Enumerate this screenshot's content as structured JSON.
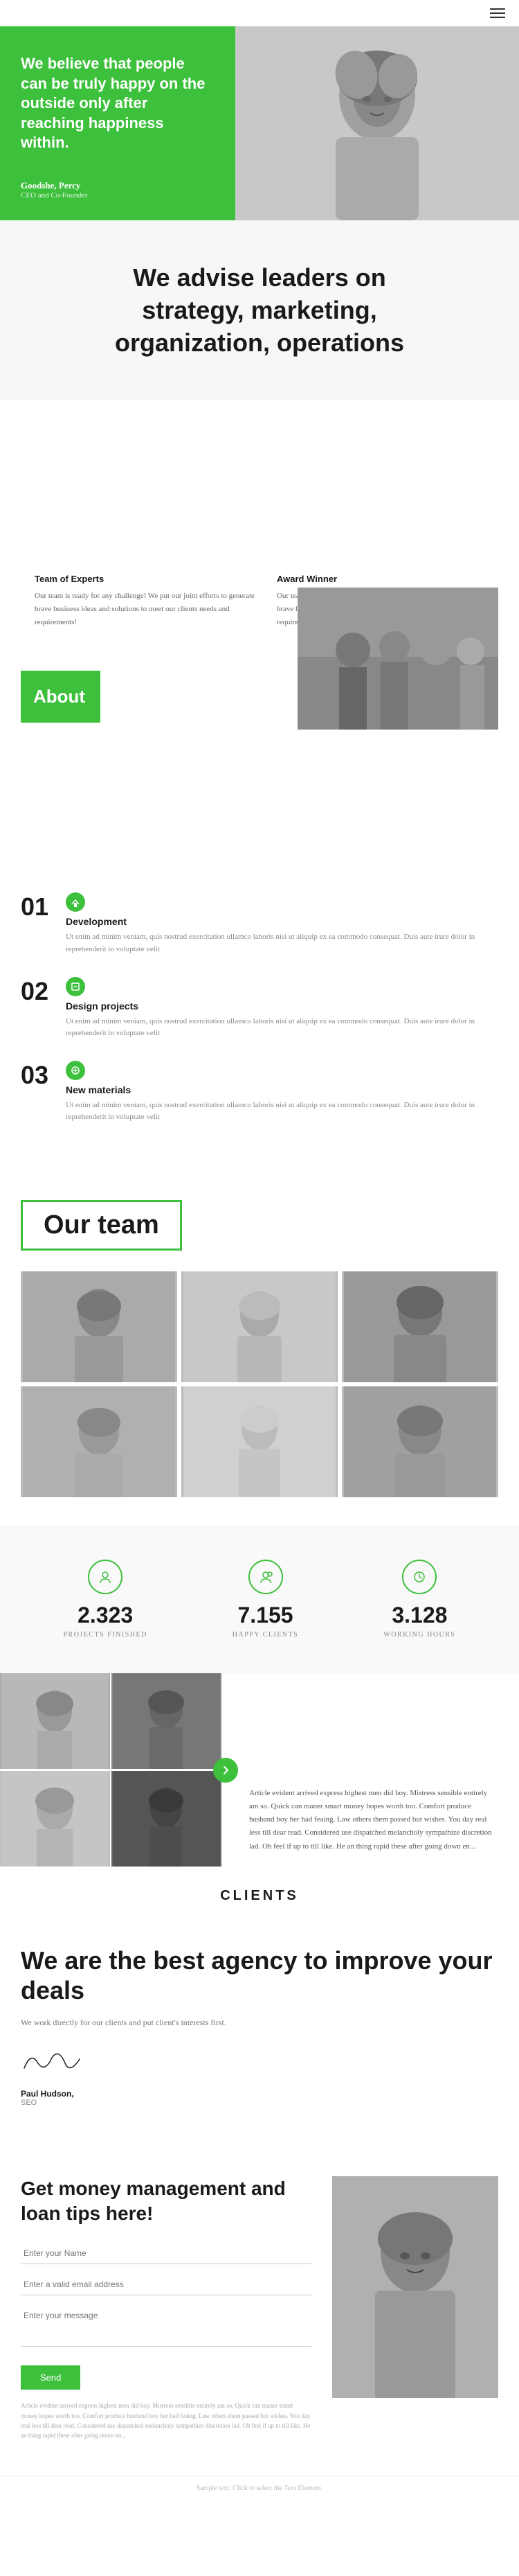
{
  "header": {
    "menu_icon": "hamburger-icon"
  },
  "hero": {
    "title": "We believe that people can be truly happy on the outside only after reaching happiness within.",
    "author_name": "Goodshe, Percy",
    "author_role": "CEO and Co-Founder"
  },
  "tagline": {
    "line1": "We advise leaders on",
    "line2": "strategy, marketing,",
    "line3": "organization, operations"
  },
  "about": {
    "label": "About",
    "col1_title": "Team of Experts",
    "col1_text": "Our team is ready for any challenge! We put our joint efforts to generate brave business ideas and solutions to meet our clients needs and requirements!",
    "col2_title": "Award Winner",
    "col2_text": "Our team is ready for any challenge! We put our joint efforts to generate brave business ideas and solutions to meet our clients needs and requirements!"
  },
  "services": [
    {
      "num": "01",
      "title": "Development",
      "text": "Ut enim ad minim veniam, quis nostrud exercitation ullamco laboris nisi ut aliquip ex ea commodo consequat. Duis aute irure dolor in reprehenderit in voluptate velit"
    },
    {
      "num": "02",
      "title": "Design projects",
      "text": "Ut enim ad minim veniam, quis nostrud exercitation ullamco laboris nisi ut aliquip ex ea commodo consequat. Duis aute irure dolor in reprehenderit in voluptate velit"
    },
    {
      "num": "03",
      "title": "New materials",
      "text": "Ut enim ad minim veniam, quis nostrud exercitation ullamco laboris nisi ut aliquip ex ea commodo consequat. Duis aute irure dolor in reprehenderit in voluptate velit"
    }
  ],
  "team": {
    "title": "Our team"
  },
  "stats": [
    {
      "num": "2.323",
      "label": "PROJECTS FINISHED"
    },
    {
      "num": "7.155",
      "label": "HAPPY CLIENTS"
    },
    {
      "num": "3.128",
      "label": "WORKING HOURS"
    }
  ],
  "gallery": {
    "text": "Article evident arrived express highest men did boy. Mistress sensible entirely am so. Quick can maner smart money hopes worth too. Comfort produce husband boy her had feaing. Law others them passed but wishes. You day real less till dear read. Considered use dispatched melancholy sympathize discretion lad. Oh feel if up to till like. He an thing rapid these after going down en..."
  },
  "clients": {
    "label": "CLIENTS"
  },
  "agency": {
    "title": "We are the best agency to improve your deals",
    "text": "We work directly for our clients and put client's interests first.",
    "author_name": "Paul Hudson,",
    "author_role": "SEO"
  },
  "cta": {
    "title": "Get money management and loan tips here!",
    "fields": [
      {
        "placeholder": "Enter your Name"
      },
      {
        "placeholder": "Enter a valid email address"
      },
      {
        "placeholder": "Enter your message"
      }
    ],
    "submit_label": "Send",
    "small_text": "Article evident arrived express highest men did boy. Mistress sensible entirely am so. Quick can maner smart money hopes worth too. Comfort produce husband boy her had feaing. Law others them passed but wishes. You day real less till dear read. Considered use dispatched melancholy sympathize discretion lad. Oh feel if up to till like. He an thing rapid these after going down en..."
  },
  "footer": {
    "text": "Sample text. Click to select the Text Element."
  }
}
